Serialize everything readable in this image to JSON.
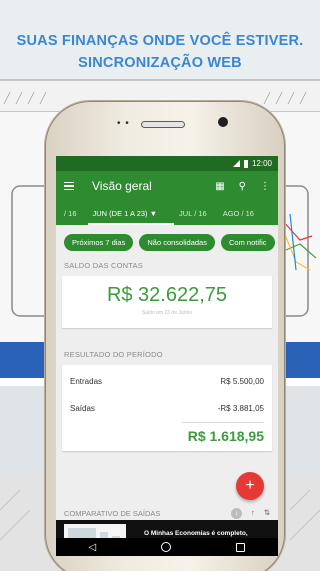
{
  "headline": {
    "line1": "SUAS FINANÇAS ONDE VOCÊ ESTIVER.",
    "line2": "SINCRONIZAÇÃO WEB"
  },
  "status_bar": {
    "time": "12:00"
  },
  "app_bar": {
    "title": "Visão geral",
    "icons": [
      "menu-icon",
      "calendar-icon",
      "search-icon",
      "more-vert-icon"
    ]
  },
  "tabs": [
    {
      "label": "/ 16"
    },
    {
      "label": "JUN (DE 1 A 23)  ▼",
      "active": true
    },
    {
      "label": "JUL / 16"
    },
    {
      "label": "AGO / 16"
    }
  ],
  "chips": [
    "Próximos 7 dias",
    "Não consolidadas",
    "Com notific"
  ],
  "accounts": {
    "label": "SALDO DAS CONTAS",
    "balance": "R$ 32.622,75",
    "note": "Saldo em 23 de Junho"
  },
  "period": {
    "label": "RESULTADO DO PERÍODO",
    "income_label": "Entradas",
    "income_value": "R$ 5.500,00",
    "expense_label": "Saídas",
    "expense_value": "-R$ 3.881,05",
    "total": "R$ 1.618,95"
  },
  "compare": {
    "label": "COMPARATIVO DE SAÍDAS"
  },
  "fab": {
    "label": "+"
  },
  "ad": {
    "text": "O Minhas Economias é completo, simples e fácil de usar."
  },
  "system_nav": {
    "back": "◁"
  },
  "colors": {
    "brand_green": "#2e8b2f",
    "value_green": "#3e9a3e",
    "fab_red": "#e53935",
    "headline_blue": "#3b86d1"
  }
}
